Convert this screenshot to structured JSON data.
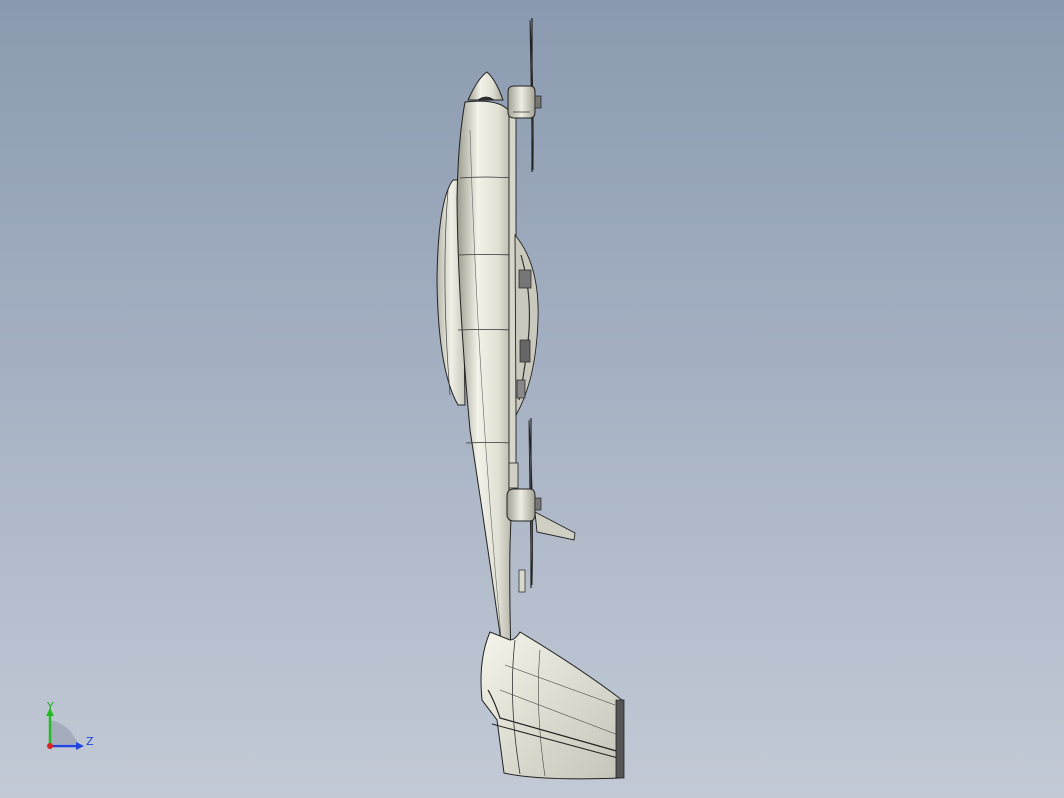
{
  "viewport": {
    "triad": {
      "y_label": "Y",
      "z_label": "Z",
      "y_color": "#22bb22",
      "z_color": "#2244dd",
      "x_color": "#dd2222"
    }
  },
  "colors": {
    "background_top": "#8b9ab0",
    "background_bottom": "#c3cad6",
    "model_fill": "#ddddd0",
    "model_edge": "#222222"
  },
  "icons": [
    "coordinate-triad-icon"
  ]
}
